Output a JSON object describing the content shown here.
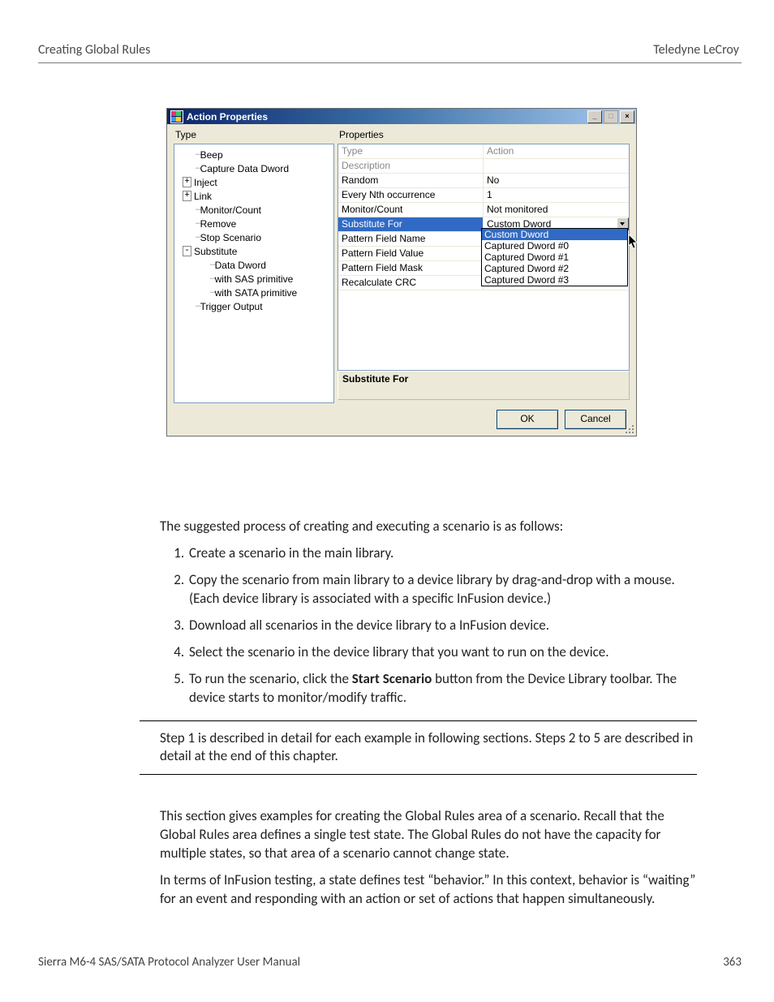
{
  "header": {
    "left": "Creating Global Rules",
    "right": "Teledyne LeCroy"
  },
  "dialog": {
    "title": "Action Properties",
    "typeLabel": "Type",
    "propsLabel": "Properties",
    "tree": [
      {
        "label": "Beep",
        "depth": 1,
        "glyph": ""
      },
      {
        "label": "Capture Data Dword",
        "depth": 1,
        "glyph": ""
      },
      {
        "label": "Inject",
        "depth": 0,
        "glyph": "+"
      },
      {
        "label": "Link",
        "depth": 0,
        "glyph": "+"
      },
      {
        "label": "Monitor/Count",
        "depth": 1,
        "glyph": ""
      },
      {
        "label": "Remove",
        "depth": 1,
        "glyph": ""
      },
      {
        "label": "Stop Scenario",
        "depth": 1,
        "glyph": ""
      },
      {
        "label": "Substitute",
        "depth": 0,
        "glyph": "-"
      },
      {
        "label": "Data Dword",
        "depth": 2,
        "glyph": ""
      },
      {
        "label": "with SAS primitive",
        "depth": 2,
        "glyph": ""
      },
      {
        "label": "with SATA primitive",
        "depth": 2,
        "glyph": ""
      },
      {
        "label": "Trigger Output",
        "depth": 1,
        "glyph": ""
      }
    ],
    "grid": [
      {
        "k": "Type",
        "v": "Action",
        "disabled": true
      },
      {
        "k": "Description",
        "v": "",
        "disabled": true
      },
      {
        "k": "Random",
        "v": "No"
      },
      {
        "k": "Every Nth occurrence",
        "v": "1"
      },
      {
        "k": "Monitor/Count",
        "v": "Not monitored"
      },
      {
        "k": "Substitute For",
        "v": "Custom Dword",
        "selected": true,
        "dd": true
      },
      {
        "k": "Pattern Field Name",
        "v": ""
      },
      {
        "k": "Pattern Field Value",
        "v": ""
      },
      {
        "k": "Pattern Field Mask",
        "v": ""
      },
      {
        "k": "Recalculate CRC",
        "v": ""
      }
    ],
    "dropdown": [
      {
        "label": "Custom Dword",
        "sel": true
      },
      {
        "label": "Captured Dword #0"
      },
      {
        "label": "Captured Dword #1"
      },
      {
        "label": "Captured Dword #2"
      },
      {
        "label": "Captured Dword #3"
      }
    ],
    "helpTitle": "Substitute For",
    "ok": "OK",
    "cancel": "Cancel"
  },
  "doc": {
    "intro": "The suggested process of creating and executing a scenario is as follows:",
    "steps": [
      "Create a scenario in the main library.",
      "Copy the scenario from main library to a device library by drag-and-drop with a mouse. (Each device library is associated with a specific InFusion device.)",
      "Download all scenarios in the device library to a InFusion device.",
      "Select the scenario in the device library that you want to run on the device.",
      ""
    ],
    "step5_pre": "To run the scenario, click the ",
    "step5_bold": "Start Scenario",
    "step5_post": " button from the Device Library toolbar. The device starts to monitor/modify traffic.",
    "callout": "Step 1 is described in detail for each example in following sections. Steps 2 to 5 are described in detail at the end of this chapter.",
    "p2": "This section gives examples for creating the Global Rules area of a scenario. Recall that the Global Rules area defines a single test state. The Global Rules do not have the capacity for multiple states, so that area of a scenario cannot change state.",
    "p3": "In terms of InFusion testing, a state defines test “behavior.” In this context, behavior is “waiting” for an event and responding with an action or set of actions that happen simultaneously."
  },
  "footer": {
    "left": "Sierra M6-4 SAS/SATA Protocol Analyzer User Manual",
    "page": "363"
  }
}
